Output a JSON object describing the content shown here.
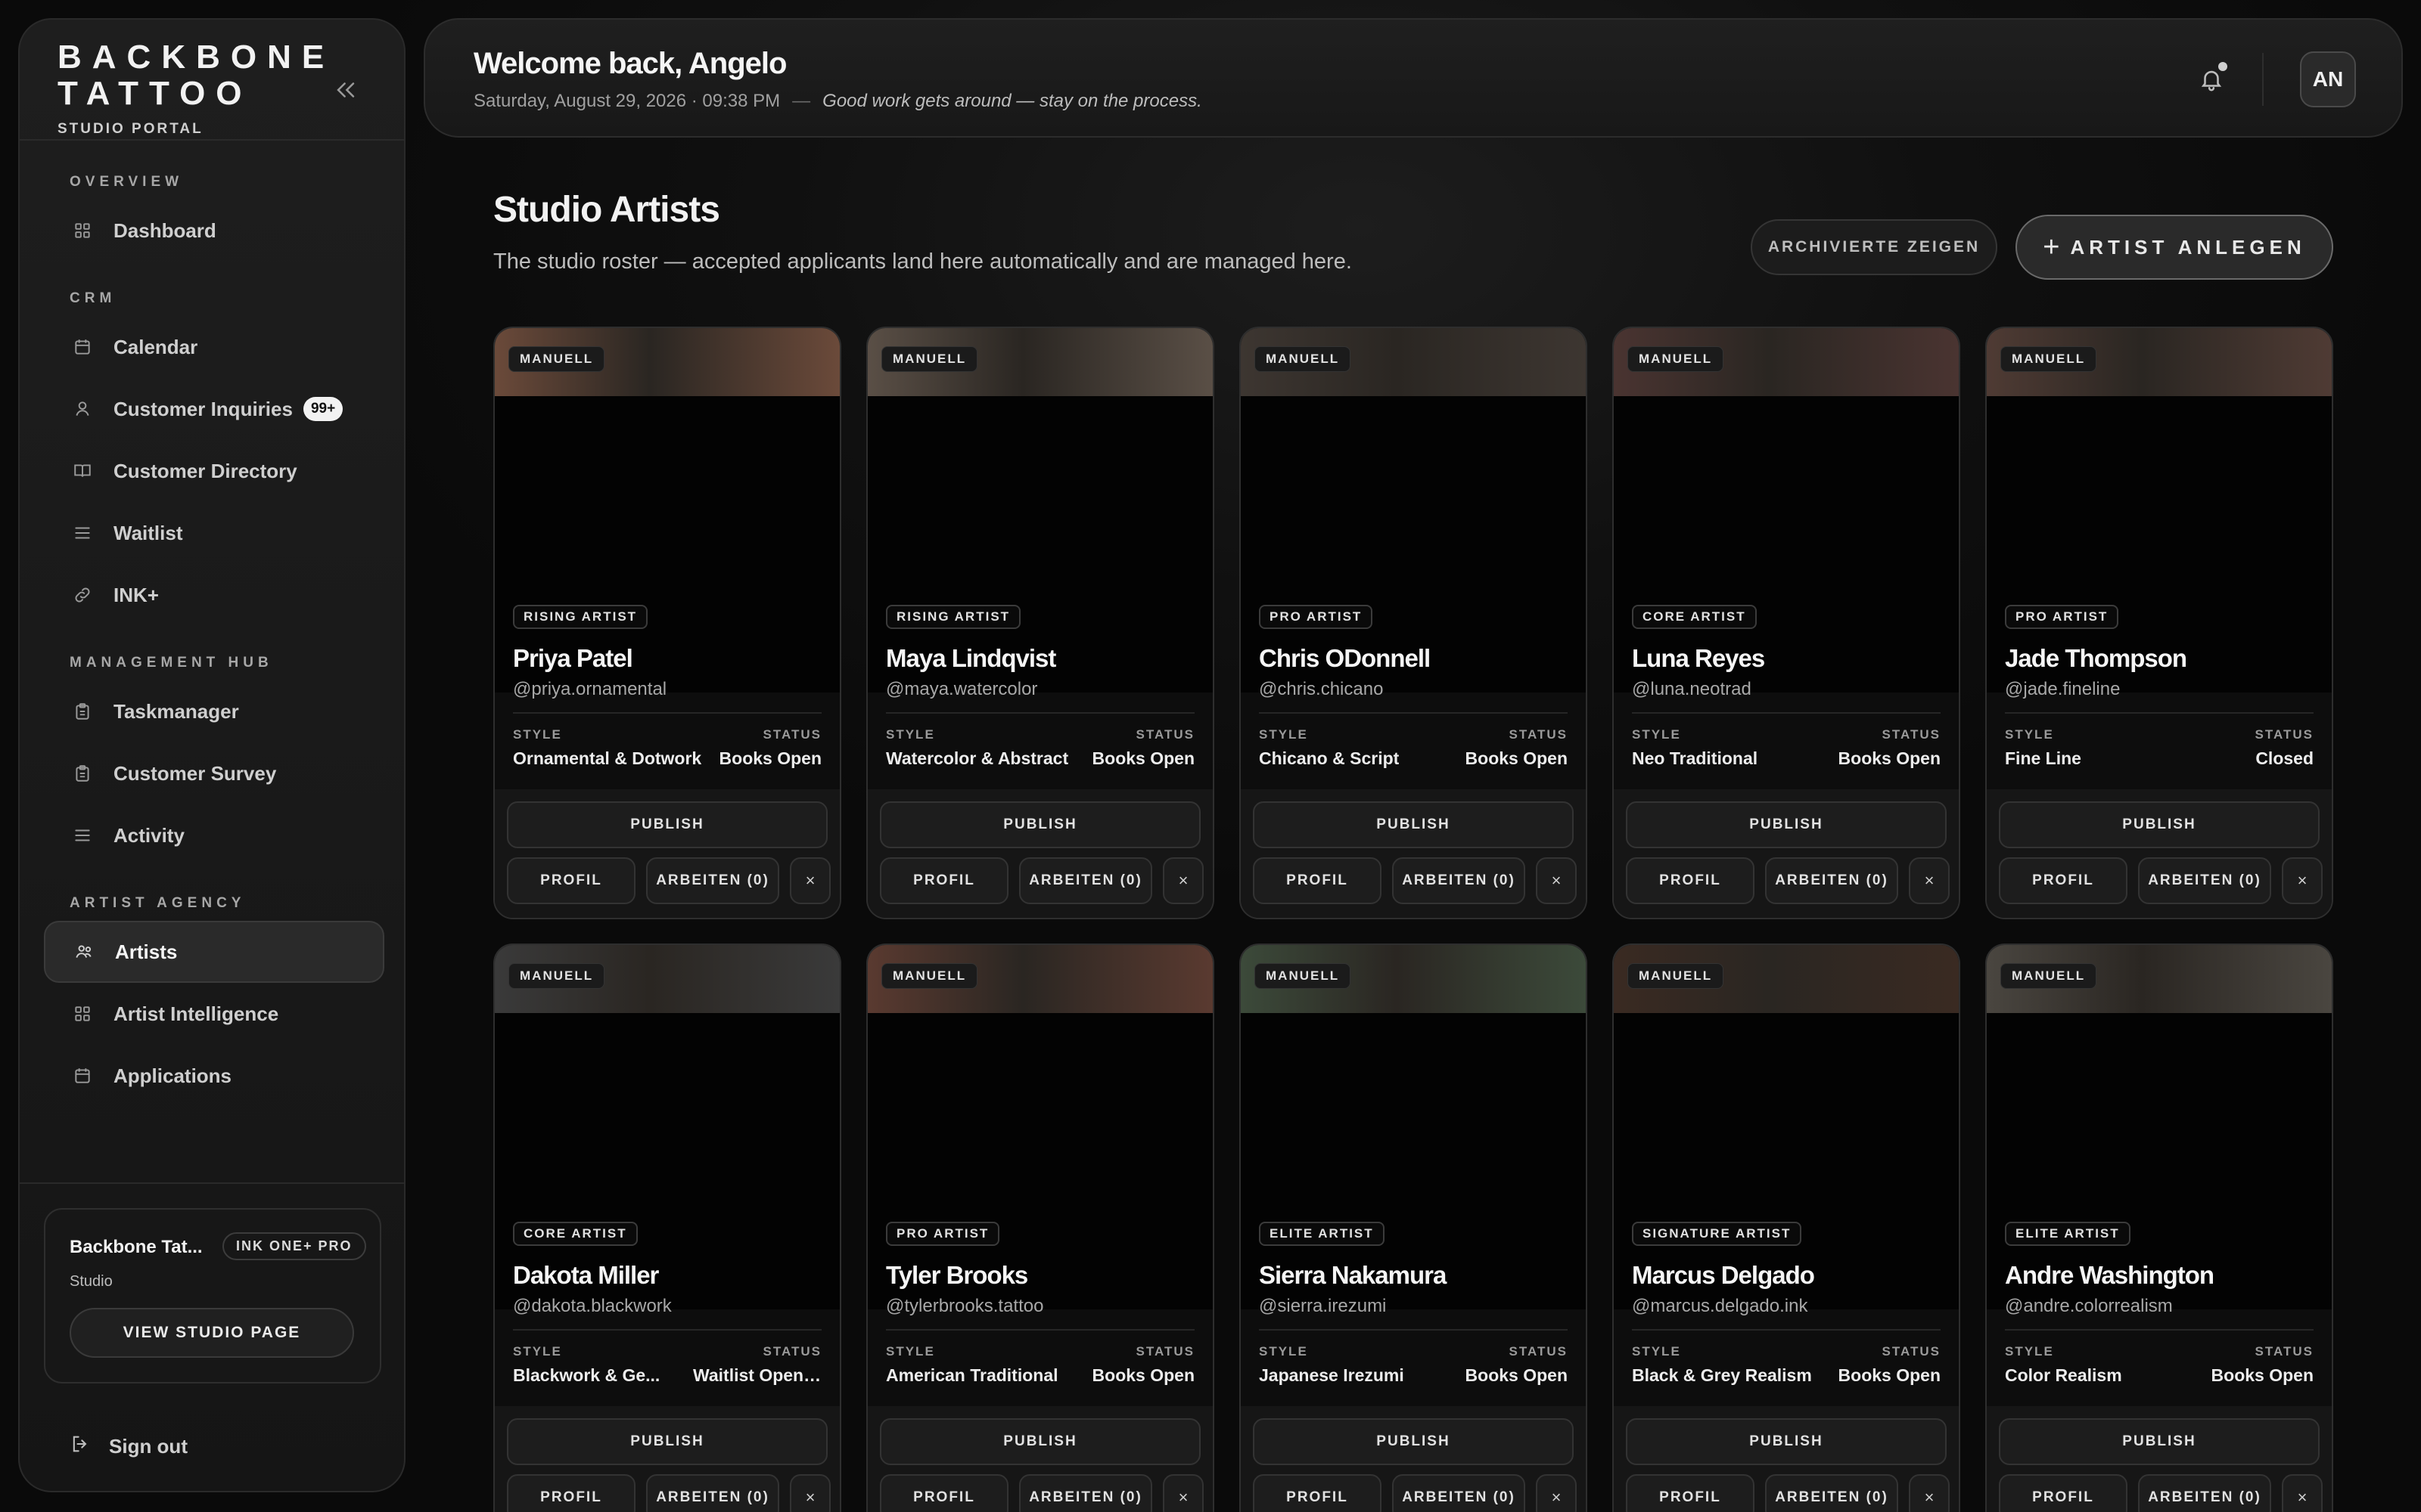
{
  "brand": {
    "title": "BACKBONE TATTOO",
    "subtitle": "STUDIO PORTAL"
  },
  "sidebar": {
    "sections": [
      {
        "label": "OVERVIEW",
        "items": [
          {
            "label": "Dashboard",
            "icon": "grid-icon"
          }
        ]
      },
      {
        "label": "CRM",
        "items": [
          {
            "label": "Calendar",
            "icon": "calendar-icon"
          },
          {
            "label": "Customer Inquiries",
            "icon": "user-icon",
            "badge": "99+"
          },
          {
            "label": "Customer Directory",
            "icon": "book-icon"
          },
          {
            "label": "Waitlist",
            "icon": "list-icon"
          },
          {
            "label": "INK+",
            "icon": "link-icon"
          }
        ]
      },
      {
        "label": "MANAGEMENT HUB",
        "items": [
          {
            "label": "Taskmanager",
            "icon": "clipboard-icon"
          },
          {
            "label": "Customer Survey",
            "icon": "clipboard-icon"
          },
          {
            "label": "Activity",
            "icon": "list-icon"
          }
        ]
      },
      {
        "label": "ARTIST AGENCY",
        "items": [
          {
            "label": "Artists",
            "icon": "users-icon",
            "active": true
          },
          {
            "label": "Artist Intelligence",
            "icon": "grid-icon"
          },
          {
            "label": "Applications",
            "icon": "calendar-icon"
          }
        ]
      }
    ],
    "studio": {
      "name": "Backbone Tat...",
      "plan": "INK ONE+ PRO",
      "type": "Studio",
      "button": "VIEW STUDIO PAGE"
    },
    "signout": "Sign out"
  },
  "header": {
    "welcome": "Welcome back, Angelo",
    "datetime": "Saturday, August 29, 2026 · 09:38 PM",
    "separator": "—",
    "tagline": "Good work gets around — stay on the process.",
    "avatar": "AN"
  },
  "main": {
    "title": "Studio Artists",
    "subtitle": "The studio roster — accepted applicants land here automatically and are managed here.",
    "archived_button": "ARCHIVIERTE ZEIGEN",
    "new_button": "ARTIST ANLEGEN",
    "card_labels": {
      "manual": "MANUELL",
      "style": "STYLE",
      "status": "STATUS",
      "publish": "PUBLISH",
      "profile": "PROFIL",
      "works": "ARBEITEN (0)",
      "close": "×"
    }
  },
  "artists": [
    {
      "tier": "RISING ARTIST",
      "name": "Priya Patel",
      "handle": "@priya.ornamental",
      "style": "Ornamental & Dotwork",
      "status": "Books Open",
      "photo": "#6b4a3a"
    },
    {
      "tier": "RISING ARTIST",
      "name": "Maya Lindqvist",
      "handle": "@maya.watercolor",
      "style": "Watercolor & Abstract",
      "status": "Books Open",
      "photo": "#5a4f46"
    },
    {
      "tier": "PRO ARTIST",
      "name": "Chris ODonnell",
      "handle": "@chris.chicano",
      "style": "Chicano & Script",
      "status": "Books Open",
      "photo": "#3d3631"
    },
    {
      "tier": "CORE ARTIST",
      "name": "Luna Reyes",
      "handle": "@luna.neotrad",
      "style": "Neo Traditional",
      "status": "Books Open",
      "photo": "#4a3431"
    },
    {
      "tier": "PRO ARTIST",
      "name": "Jade Thompson",
      "handle": "@jade.fineline",
      "style": "Fine Line",
      "status": "Closed",
      "photo": "#4f3b34"
    },
    {
      "tier": "CORE ARTIST",
      "name": "Dakota Miller",
      "handle": "@dakota.blackwork",
      "style": "Blackwork & Ge...",
      "status": "Waitlist Openin...",
      "photo": "#3a3a3a"
    },
    {
      "tier": "PRO ARTIST",
      "name": "Tyler Brooks",
      "handle": "@tylerbrooks.tattoo",
      "style": "American Traditional",
      "status": "Books Open",
      "photo": "#5a3a30"
    },
    {
      "tier": "ELITE ARTIST",
      "name": "Sierra Nakamura",
      "handle": "@sierra.irezumi",
      "style": "Japanese Irezumi",
      "status": "Books Open",
      "photo": "#3c4a3a"
    },
    {
      "tier": "SIGNATURE ARTIST",
      "name": "Marcus Delgado",
      "handle": "@marcus.delgado.ink",
      "style": "Black & Grey Realism",
      "status": "Books Open",
      "photo": "#3a2a22"
    },
    {
      "tier": "ELITE ARTIST",
      "name": "Andre Washington",
      "handle": "@andre.colorrealism",
      "style": "Color Realism",
      "status": "Books Open",
      "photo": "#4a4640"
    }
  ]
}
